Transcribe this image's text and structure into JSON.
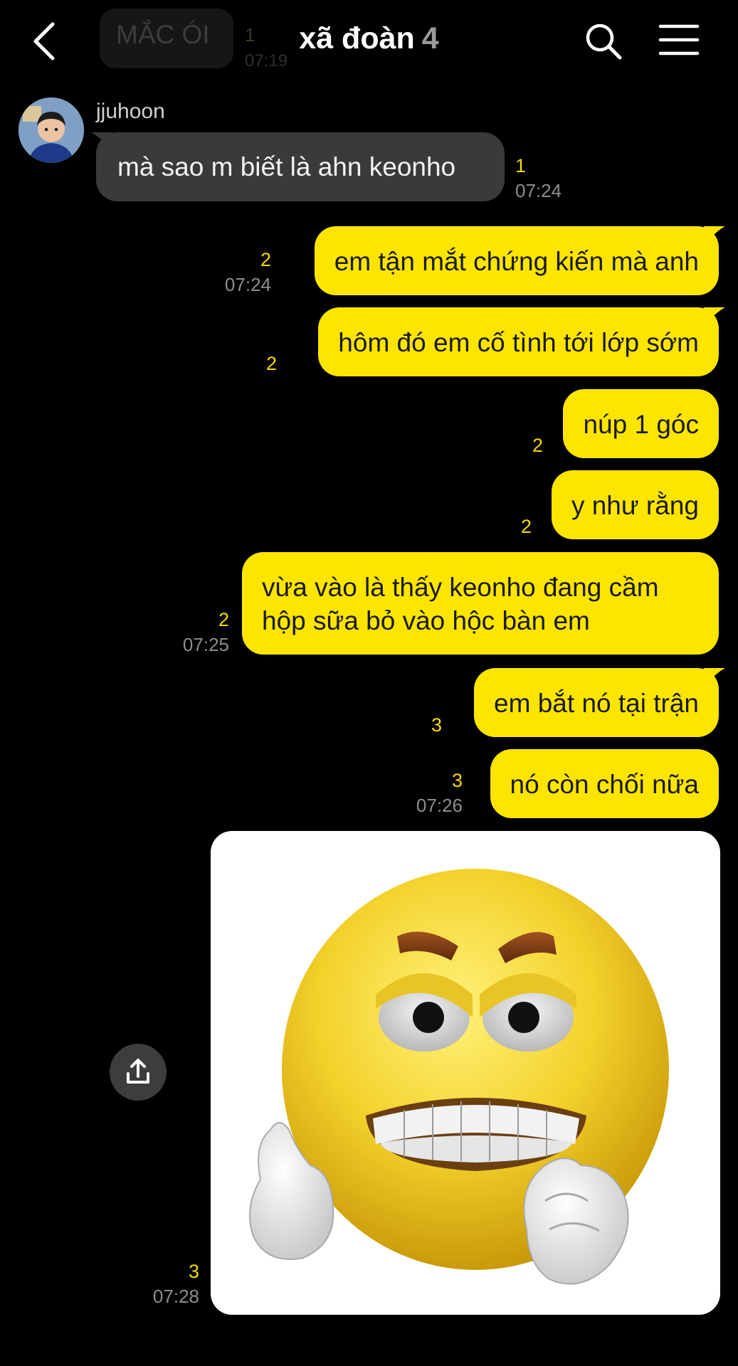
{
  "header": {
    "title": "xã đoàn",
    "member_count": "4",
    "ghost_message": {
      "text": "MẮC ÓI",
      "unread": "1",
      "time": "07:19"
    }
  },
  "messages": [
    {
      "id": "m1",
      "direction": "in",
      "sender": "jjuhoon",
      "text": "mà sao m biết là ahn keonho",
      "unread": "1",
      "time": "07:24"
    },
    {
      "id": "m2",
      "direction": "out",
      "text": "em tận mắt chứng kiến mà anh",
      "unread": "2",
      "time": "07:24"
    },
    {
      "id": "m3",
      "direction": "out",
      "text": "hôm đó em cố tình tới lớp sớm",
      "unread": "2",
      "time": ""
    },
    {
      "id": "m4",
      "direction": "out",
      "text": "núp 1 góc",
      "unread": "2",
      "time": ""
    },
    {
      "id": "m5",
      "direction": "out",
      "text": "y như rằng",
      "unread": "2",
      "time": ""
    },
    {
      "id": "m6",
      "direction": "out",
      "text_line1": "vừa vào là thấy keonho đang cầm",
      "text_line2": "hộp sữa bỏ vào hộc bàn em",
      "unread": "2",
      "time": "07:25"
    },
    {
      "id": "m7",
      "direction": "out",
      "text": "em bắt nó tại trận",
      "unread": "3",
      "time": ""
    },
    {
      "id": "m8",
      "direction": "out",
      "text": "nó còn chối nữa",
      "unread": "3",
      "time": "07:26"
    },
    {
      "id": "m9",
      "direction": "out",
      "type": "image",
      "image": "angry-emoji-sticker",
      "unread": "3",
      "time": "07:28"
    }
  ],
  "icons": {
    "back": "chevron-left-icon",
    "search": "search-icon",
    "menu": "hamburger-menu-icon",
    "share": "share-upload-icon"
  },
  "colors": {
    "background": "#000000",
    "outgoing_bubble": "#fee500",
    "incoming_bubble": "#3a3a3c",
    "unread_count": "#f5d800",
    "timestamp": "#8d8d8d"
  }
}
